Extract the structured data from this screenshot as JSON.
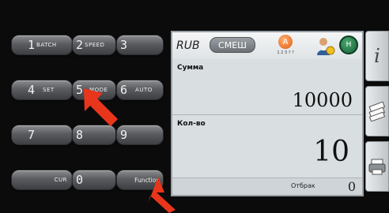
{
  "keypad": {
    "row1": [
      {
        "digit": "1",
        "label": "BATCH"
      },
      {
        "digit": "2",
        "label": "SPEED"
      },
      {
        "digit": "3",
        "label": ""
      }
    ],
    "row2": [
      {
        "digit": "4",
        "label": "SET"
      },
      {
        "digit": "5",
        "label": "MODE"
      },
      {
        "digit": "6",
        "label": "AUTO"
      }
    ],
    "row3": [
      {
        "digit": "7",
        "label": ""
      },
      {
        "digit": "8",
        "label": ""
      },
      {
        "digit": "9",
        "label": ""
      }
    ],
    "row4": [
      {
        "digit": "",
        "label": "CUR"
      },
      {
        "digit": "0",
        "label": ""
      },
      {
        "digit": "",
        "label": "Function"
      }
    ]
  },
  "display": {
    "currency": "RUB",
    "mode": "СМЕШ",
    "auto_letter": "A",
    "auto_sub": "1 2 3 ? ?",
    "h_letter": "H",
    "amount_label": "Сумма",
    "amount_value": "10000",
    "count_label": "Кол-во",
    "count_value": "10",
    "reject_label": "Отбрак",
    "reject_value": "0"
  },
  "side_panel": {
    "info_glyph": "i"
  },
  "colors": {
    "arrow": "#e8361c",
    "screen_bg": "#d6dbdf",
    "key_gradient_top": "#8b8d90"
  }
}
